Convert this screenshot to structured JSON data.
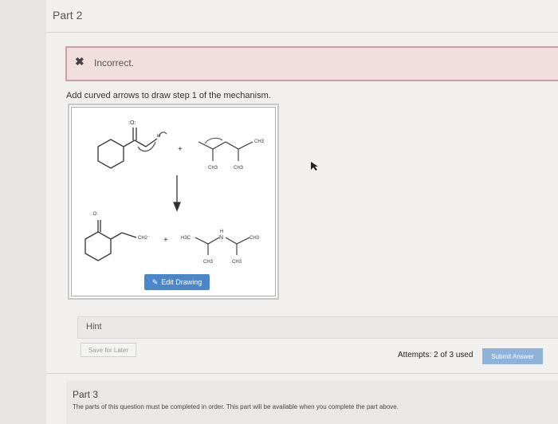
{
  "part2": {
    "title": "Part 2"
  },
  "feedback": {
    "icon": "close-icon",
    "message": "Incorrect."
  },
  "question": {
    "instruction": "Add curved arrows to draw step 1 of the mechanism."
  },
  "drawing": {
    "plus": "+",
    "reactant_labels": {
      "o": ":O:",
      "h": "H",
      "ch3": "CH3"
    },
    "product_labels": {
      "o": ":O:",
      "carbanion": "CH2⁻",
      "h3c": "H3C",
      "n": "N",
      "h": "H",
      "ch3": "CH3"
    },
    "edit_button": "Edit Drawing"
  },
  "hint": {
    "label": "Hint"
  },
  "footer": {
    "save_label": "Save for Later",
    "attempts": "Attempts: 2 of 3 used",
    "submit_label": "Submit Answer"
  },
  "part3": {
    "title": "Part 3",
    "description": "The parts of this question must be completed in order. This part will be available when you complete the part above."
  },
  "colors": {
    "alert_bg": "#f3dede",
    "alert_border": "#c9a0a3",
    "button_blue": "#4a86c8"
  }
}
